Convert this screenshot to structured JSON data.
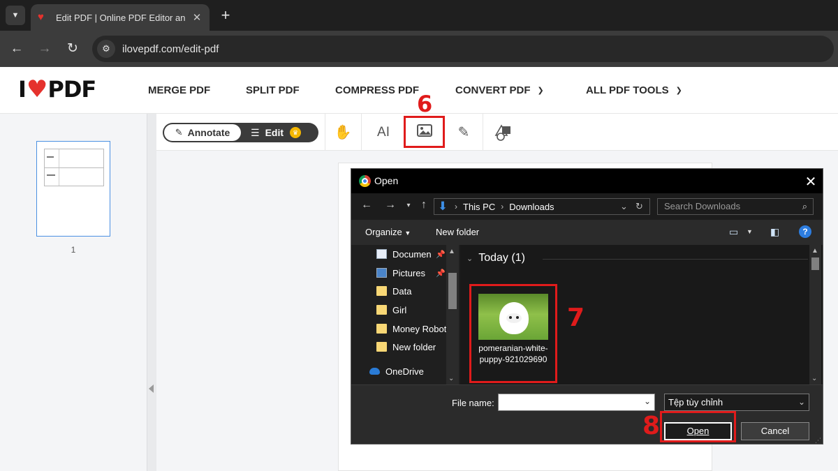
{
  "browser": {
    "tab_title": "Edit PDF | Online PDF Editor and Form Filler",
    "url": "ilovepdf.com/edit-pdf"
  },
  "site": {
    "logo_left": "I",
    "logo_right": "PDF",
    "menu": [
      {
        "label": "MERGE PDF"
      },
      {
        "label": "SPLIT PDF"
      },
      {
        "label": "COMPRESS PDF"
      },
      {
        "label": "CONVERT PDF"
      },
      {
        "label": "ALL PDF TOOLS"
      }
    ]
  },
  "editor": {
    "mode_annotate": "Annotate",
    "mode_edit": "Edit",
    "page_number": "1",
    "tools": [
      "hand-icon",
      "text-icon",
      "image-icon",
      "pencil-icon",
      "shapes-icon"
    ]
  },
  "dialog": {
    "title": "Open",
    "path": [
      "This PC",
      "Downloads"
    ],
    "search_placeholder": "Search Downloads",
    "organize": "Organize",
    "new_folder": "New folder",
    "nav_items": [
      {
        "label": "Documen",
        "icon": "document-folder-icon",
        "pinned": true
      },
      {
        "label": "Pictures",
        "icon": "pictures-folder-icon",
        "pinned": true
      },
      {
        "label": "Data",
        "icon": "folder-icon"
      },
      {
        "label": "Girl",
        "icon": "folder-icon"
      },
      {
        "label": "Money Robot",
        "icon": "folder-icon"
      },
      {
        "label": "New folder",
        "icon": "folder-icon"
      },
      {
        "label": "OneDrive",
        "icon": "onedrive-icon"
      }
    ],
    "group_header": "Today (1)",
    "file": {
      "name": "pomeranian-white-puppy-921029690"
    },
    "file_name_label": "File name:",
    "file_name_value": "",
    "file_type": "Tệp tùy chỉnh",
    "open_button": "Open",
    "cancel_button": "Cancel"
  },
  "annotations": {
    "step6": "6",
    "step7": "7",
    "step8": "8",
    "color": "#e01b1b"
  }
}
